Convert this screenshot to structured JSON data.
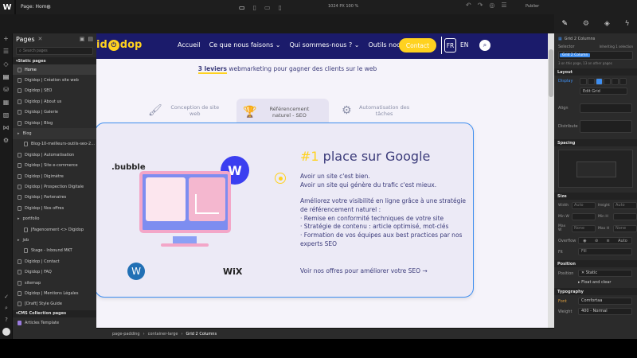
{
  "topbar": {
    "page_label": "Page: Home",
    "dims": "1024 PX  100 %",
    "publish": "Publier"
  },
  "pages_panel": {
    "title": "Pages",
    "search_placeholder": "Search pages",
    "static_header": "Static pages",
    "cms_header": "CMS Collection pages",
    "items": [
      "Home",
      "Digidop | Création site web",
      "Digidop | SEO",
      "Digidop | About us",
      "Digidop | Galerie",
      "Digidop | Blog",
      "Blog",
      "Blog-10-meilleurs-outils-seo-2...",
      "Digidop | Automatisation",
      "Digidop | Site e-commerce",
      "Digidop | Digimètre",
      "Digidop | Prospection Digitale",
      "Digidop | Partenaires",
      "Digidop | Nos offres",
      "portfolio",
      "JFagencement <> Digidop",
      "job",
      "Stage - Inbound MKT",
      "Digidop | Contact",
      "Digidop | FAQ",
      "sitemap",
      "Digidop | Mentions Légales",
      "[Draft] Style Guide"
    ],
    "cms_items": [
      "Articles Template"
    ]
  },
  "site": {
    "logo_text": "dop",
    "nav": [
      "Accueil",
      "Ce que nous faisons",
      "Qui sommes-nous ?",
      "Outils nocodes"
    ],
    "contact": "Contact",
    "lang_fr": "FR",
    "lang_en": "EN",
    "tagline_strong": "3 leviers",
    "tagline_rest": " webmarketing pour gagner des clients sur le web",
    "tabs": [
      {
        "label": "Conception de site web"
      },
      {
        "label": "Référencement naturel - SEO"
      },
      {
        "label": "Automatisation des tâches"
      }
    ],
    "card": {
      "title_num": "#1",
      "title_rest": " place sur Google",
      "p1": "Avoir un site c'est bien.",
      "p2": "Avoir un site qui génère du trafic c'est mieux.",
      "p3": "Améliorez votre visibilité en ligne grâce à une stratégie de référencement naturel :",
      "b1": "· Remise en conformité techniques de votre site",
      "b2": "· Stratégie de contenu : article optimisé, mot-clés",
      "b3": "· Formation de vos équipes aux best practices par nos experts SEO",
      "cta": "Voir nos offres pour améliorer votre SEO →"
    },
    "logos": {
      "bubble": ".bubble",
      "wix": "WiX"
    }
  },
  "breadcrumb": [
    "page-padding",
    "container-large",
    "Grid 2 Columns"
  ],
  "right_panel": {
    "element": "Grid 2 Columns",
    "selector": "Selector",
    "inheriting": "Inheriting 1 selection",
    "chip": "Grid 2 Column",
    "note": "3 on this page, 13 on other pages",
    "layout": "Layout",
    "display": "Display",
    "edit_grid": "Edit Grid",
    "align": "Align",
    "distribute": "Distribute",
    "spacing": "Spacing",
    "size": "Size",
    "width": "Width",
    "height": "Height",
    "min_w": "Min W",
    "min_h": "Min H",
    "max_w": "Max W",
    "max_h": "Max H",
    "auto": "Auto",
    "none": "None",
    "overflow": "Overflow",
    "fit": "Fit",
    "fill": "Fill",
    "position": "Position",
    "static": "Static",
    "float": "Float and clear",
    "typography": "Typography",
    "font": "Font",
    "font_val": "Comfortaa",
    "weight": "Weight",
    "weight_val": "400 - Normal"
  },
  "colors": {
    "accent": "#ffd21f",
    "navy": "#1b1b6b",
    "canvas": "#f5f3fa"
  }
}
